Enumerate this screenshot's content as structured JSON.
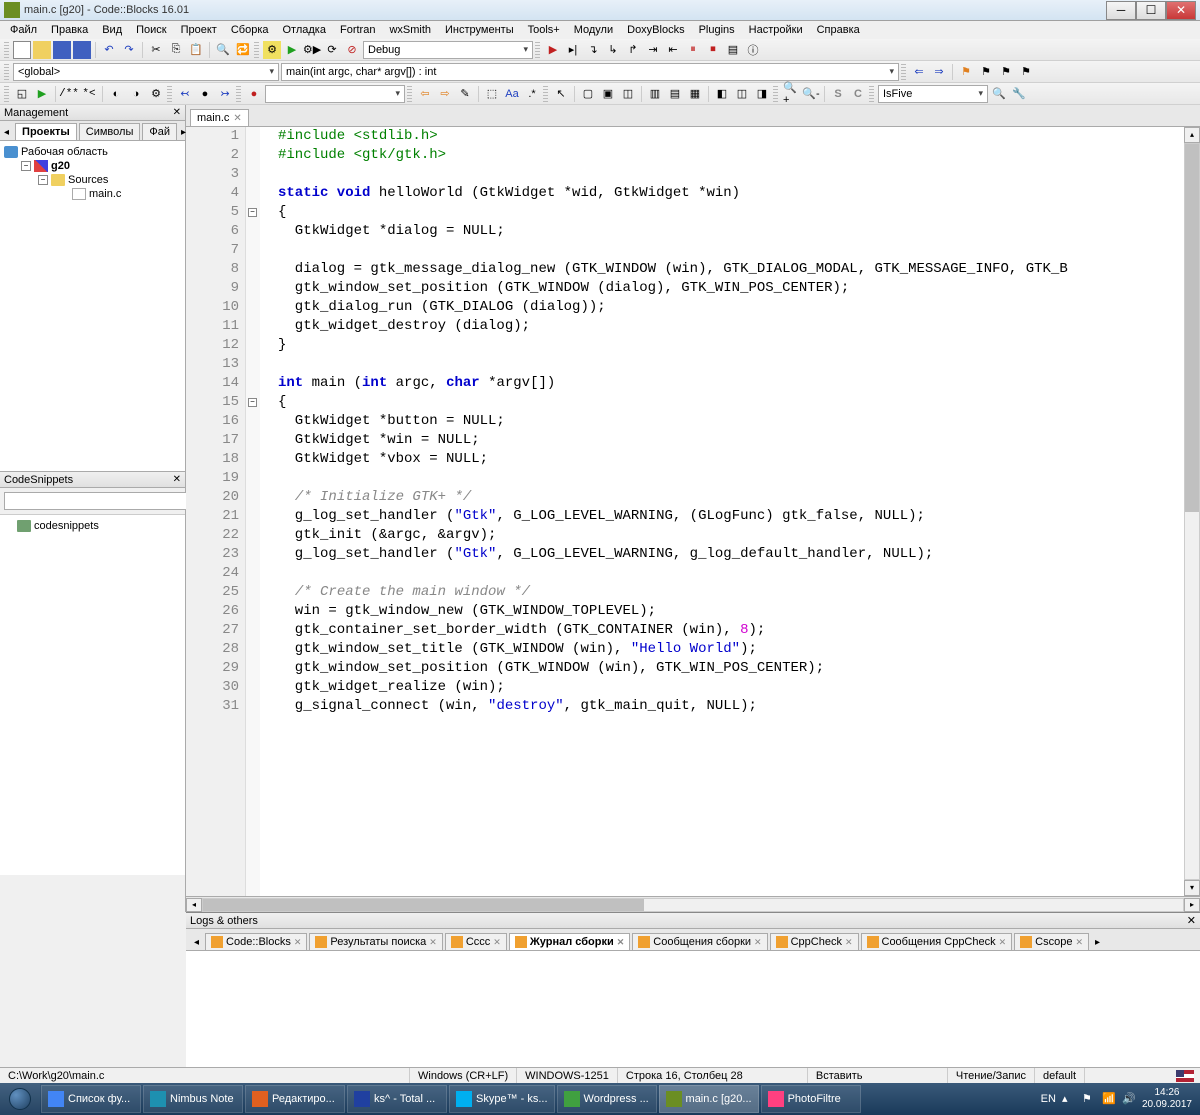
{
  "window": {
    "title": "main.c [g20] - Code::Blocks 16.01"
  },
  "menu": [
    "Файл",
    "Правка",
    "Вид",
    "Поиск",
    "Проект",
    "Сборка",
    "Отладка",
    "Fortran",
    "wxSmith",
    "Инструменты",
    "Tools+",
    "Модули",
    "DoxyBlocks",
    "Plugins",
    "Настройки",
    "Справка"
  ],
  "toolbar2": {
    "scope": "<global>",
    "func": "main(int argc, char* argv[]) : int",
    "target": "Debug",
    "search": "IsFive"
  },
  "management": {
    "title": "Management",
    "tabs": [
      "Проекты",
      "Символы",
      "Фай"
    ],
    "tree": {
      "workspace": "Рабочая область",
      "project": "g20",
      "sources": "Sources",
      "file": "main.c"
    }
  },
  "snippets": {
    "title": "CodeSnippets",
    "root": "codesnippets"
  },
  "editor": {
    "tab": "main.c"
  },
  "code_lines": [
    [
      {
        "t": "#include <stdlib.h>",
        "c": "pp"
      }
    ],
    [
      {
        "t": "#include <gtk/gtk.h>",
        "c": "pp"
      }
    ],
    [
      {
        "t": "",
        "c": ""
      }
    ],
    [
      {
        "t": "static void",
        "c": "kw"
      },
      {
        "t": " helloWorld (GtkWidget *wid, GtkWidget *win)",
        "c": ""
      }
    ],
    [
      {
        "t": "{",
        "c": ""
      }
    ],
    [
      {
        "t": "  GtkWidget *dialog = NULL;",
        "c": ""
      }
    ],
    [
      {
        "t": "",
        "c": ""
      }
    ],
    [
      {
        "t": "  dialog = gtk_message_dialog_new (GTK_WINDOW (win), GTK_DIALOG_MODAL, GTK_MESSAGE_INFO, GTK_B",
        "c": ""
      }
    ],
    [
      {
        "t": "  gtk_window_set_position (GTK_WINDOW (dialog), GTK_WIN_POS_CENTER);",
        "c": ""
      }
    ],
    [
      {
        "t": "  gtk_dialog_run (GTK_DIALOG (dialog));",
        "c": ""
      }
    ],
    [
      {
        "t": "  gtk_widget_destroy (dialog);",
        "c": ""
      }
    ],
    [
      {
        "t": "}",
        "c": ""
      }
    ],
    [
      {
        "t": "",
        "c": ""
      }
    ],
    [
      {
        "t": "int",
        "c": "kw"
      },
      {
        "t": " main (",
        "c": ""
      },
      {
        "t": "int",
        "c": "kw"
      },
      {
        "t": " argc, ",
        "c": ""
      },
      {
        "t": "char",
        "c": "kw"
      },
      {
        "t": " *argv[])",
        "c": ""
      }
    ],
    [
      {
        "t": "{",
        "c": ""
      }
    ],
    [
      {
        "t": "  GtkWidget *button = NULL;",
        "c": ""
      }
    ],
    [
      {
        "t": "  GtkWidget *win = NULL;",
        "c": ""
      }
    ],
    [
      {
        "t": "  GtkWidget *vbox = NULL;",
        "c": ""
      }
    ],
    [
      {
        "t": "",
        "c": ""
      }
    ],
    [
      {
        "t": "  ",
        "c": ""
      },
      {
        "t": "/* Initialize GTK+ */",
        "c": "cmt"
      }
    ],
    [
      {
        "t": "  g_log_set_handler (",
        "c": ""
      },
      {
        "t": "\"Gtk\"",
        "c": "str"
      },
      {
        "t": ", G_LOG_LEVEL_WARNING, (GLogFunc) gtk_false, NULL);",
        "c": ""
      }
    ],
    [
      {
        "t": "  gtk_init (&argc, &argv);",
        "c": ""
      }
    ],
    [
      {
        "t": "  g_log_set_handler (",
        "c": ""
      },
      {
        "t": "\"Gtk\"",
        "c": "str"
      },
      {
        "t": ", G_LOG_LEVEL_WARNING, g_log_default_handler, NULL);",
        "c": ""
      }
    ],
    [
      {
        "t": "",
        "c": ""
      }
    ],
    [
      {
        "t": "  ",
        "c": ""
      },
      {
        "t": "/* Create the main window */",
        "c": "cmt"
      }
    ],
    [
      {
        "t": "  win = gtk_window_new (GTK_WINDOW_TOPLEVEL);",
        "c": ""
      }
    ],
    [
      {
        "t": "  gtk_container_set_border_width (GTK_CONTAINER (win), ",
        "c": ""
      },
      {
        "t": "8",
        "c": "num"
      },
      {
        "t": ");",
        "c": ""
      }
    ],
    [
      {
        "t": "  gtk_window_set_title (GTK_WINDOW (win), ",
        "c": ""
      },
      {
        "t": "\"Hello World\"",
        "c": "str"
      },
      {
        "t": ");",
        "c": ""
      }
    ],
    [
      {
        "t": "  gtk_window_set_position (GTK_WINDOW (win), GTK_WIN_POS_CENTER);",
        "c": ""
      }
    ],
    [
      {
        "t": "  gtk_widget_realize (win);",
        "c": ""
      }
    ],
    [
      {
        "t": "  g_signal_connect (win, ",
        "c": ""
      },
      {
        "t": "\"destroy\"",
        "c": "str"
      },
      {
        "t": ", gtk_main_quit, NULL);",
        "c": ""
      }
    ]
  ],
  "logs": {
    "title": "Logs & others",
    "tabs": [
      "Code::Blocks",
      "Результаты поиска",
      "Cccc",
      "Журнал сборки",
      "Сообщения сборки",
      "CppCheck",
      "Сообщения CppCheck",
      "Cscope"
    ],
    "active": 3
  },
  "status": {
    "path": "C:\\Work\\g20\\main.c",
    "eol": "Windows (CR+LF)",
    "enc": "WINDOWS-1251",
    "pos": "Строка 16, Столбец 28",
    "ins": "Вставить",
    "rw": "Чтение/Запис",
    "profile": "default"
  },
  "taskbar": {
    "items": [
      {
        "label": "Список фу...",
        "icon": "#4285f4"
      },
      {
        "label": "Nimbus Note",
        "icon": "#1e90b0"
      },
      {
        "label": "Редактиро...",
        "icon": "#e06020"
      },
      {
        "label": "ks^ - Total ...",
        "icon": "#2040a0"
      },
      {
        "label": "Skype™ - ks...",
        "icon": "#00aff0"
      },
      {
        "label": "Wordpress ...",
        "icon": "#40a040"
      },
      {
        "label": "main.c [g20...",
        "icon": "#6b8e23",
        "active": true
      },
      {
        "label": "PhotoFiltre",
        "icon": "#ff4080"
      }
    ],
    "lang": "EN",
    "time": "14:26",
    "date": "20.09.2017"
  }
}
